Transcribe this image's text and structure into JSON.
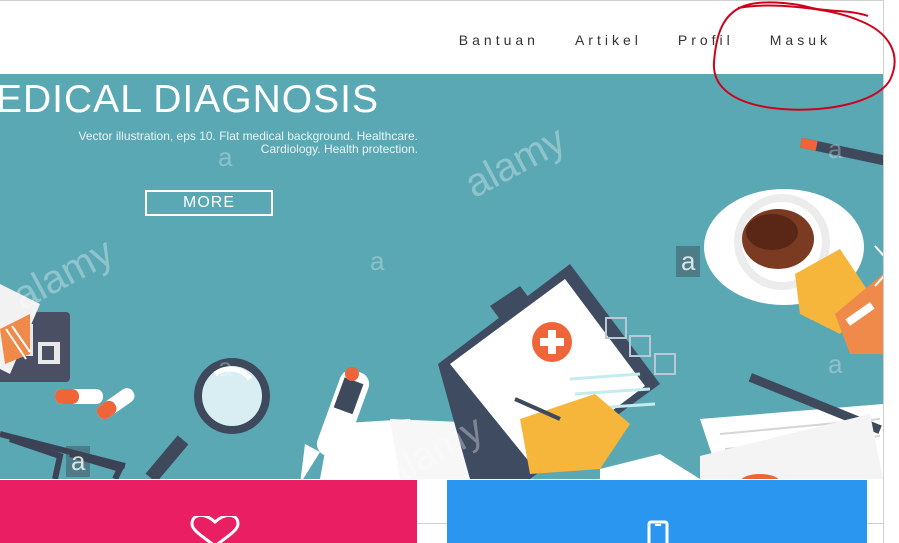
{
  "nav": {
    "items": [
      "Bantuan",
      "Artikel",
      "Profil",
      "Masuk"
    ]
  },
  "hero": {
    "title": "EDICAL DIAGNOSIS",
    "subtitle_line1": "Vector illustration, eps 10. Flat medical background. Healthcare.",
    "subtitle_line2": "Cardiology. Health protection.",
    "more_label": "MORE",
    "watermark": "alamy",
    "watermark_small": "a"
  },
  "cards": {
    "left_icon": "heart-outline-icon",
    "right_icon": "mobile-phone-icon"
  },
  "colors": {
    "hero_bg": "#5aa8b4",
    "card_red": "#ea1f63",
    "card_blue": "#2a96ef",
    "annotation": "#d0021b"
  }
}
